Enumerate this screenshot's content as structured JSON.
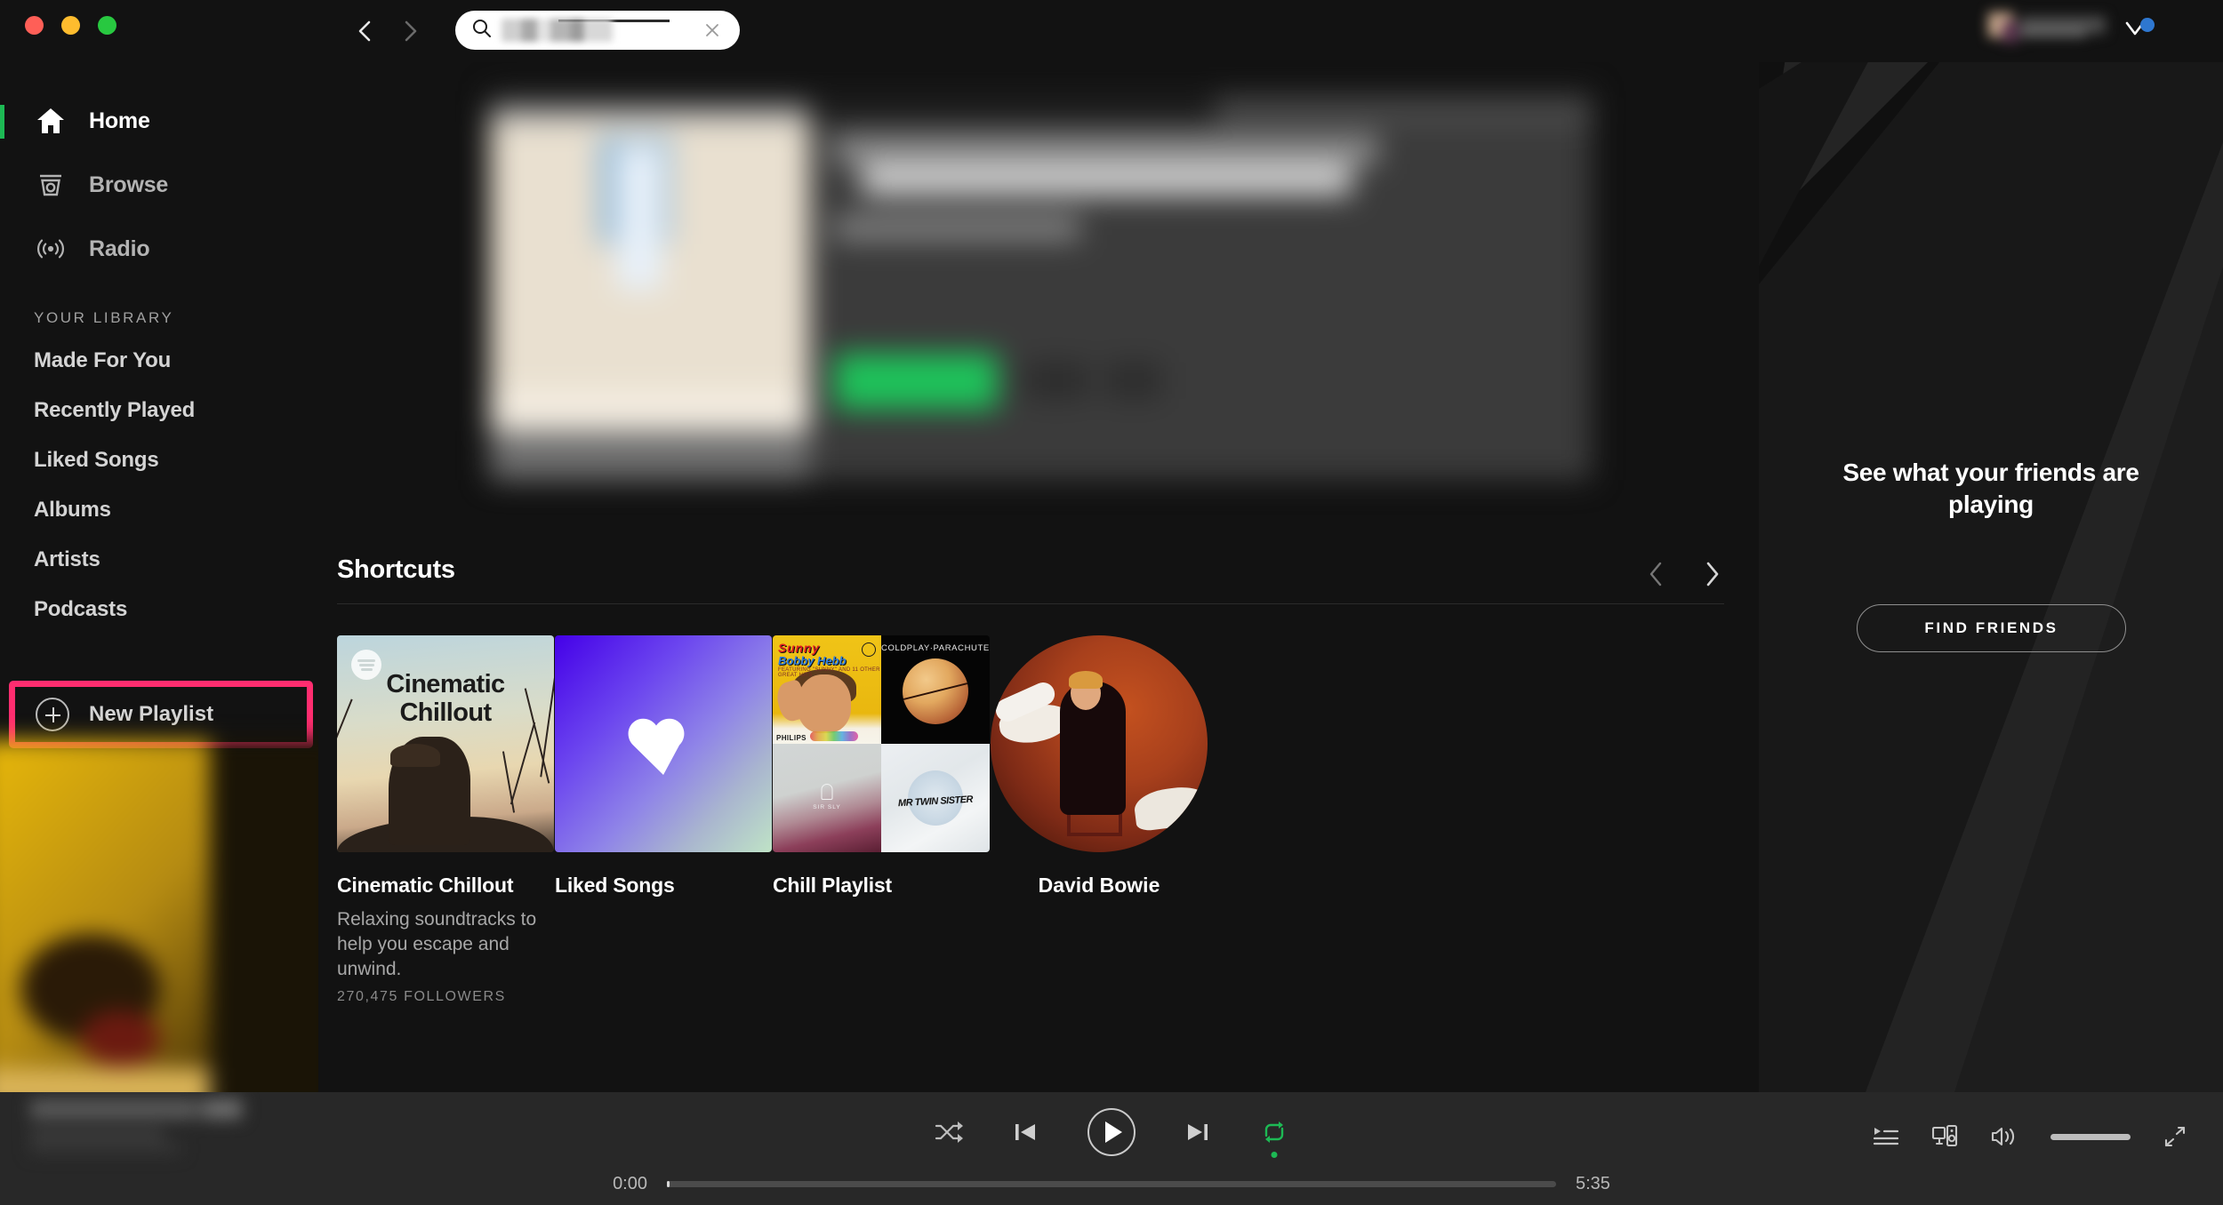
{
  "window": {
    "traffic_lights": [
      "close",
      "minimize",
      "zoom"
    ],
    "colors": {
      "close": "#FF5F57",
      "minimize": "#FEBC2E",
      "zoom": "#28C840"
    }
  },
  "topbar": {
    "back_icon": "chevron-left-icon",
    "forward_icon": "chevron-right-icon",
    "search": {
      "icon": "search-icon",
      "value": "",
      "placeholder": "",
      "redacted": true,
      "clear_icon": "close-icon"
    },
    "user": {
      "name": "",
      "redacted": true,
      "chevron_icon": "chevron-down-icon",
      "badge_color": "#2e77d0"
    }
  },
  "sidebar": {
    "nav": [
      {
        "label": "Home",
        "icon": "home-icon",
        "active": true
      },
      {
        "label": "Browse",
        "icon": "browse-icon",
        "active": false
      },
      {
        "label": "Radio",
        "icon": "radio-icon",
        "active": false
      }
    ],
    "library_heading": "YOUR LIBRARY",
    "library": [
      {
        "label": "Made For You"
      },
      {
        "label": "Recently Played"
      },
      {
        "label": "Liked Songs"
      },
      {
        "label": "Albums"
      },
      {
        "label": "Artists"
      },
      {
        "label": "Podcasts"
      }
    ],
    "new_playlist": {
      "label": "New Playlist",
      "icon": "plus-circle-icon",
      "highlighted": true,
      "highlight_color": "#FF2D6F"
    },
    "active_indicator_color": "#1DB954"
  },
  "main": {
    "hero": {
      "redacted": true,
      "has_green_button": true
    },
    "shortcuts": {
      "title": "Shortcuts",
      "prev_icon": "chevron-left-icon",
      "next_icon": "chevron-right-icon",
      "cards": [
        {
          "title": "Cinematic Chillout",
          "description": "Relaxing soundtracks to help you escape and unwind.",
          "subtitle": "270,475 FOLLOWERS",
          "art_text_line1": "Cinematic",
          "art_text_line2": "Chillout",
          "art_badge": "spotify-logo-icon",
          "shape": "square"
        },
        {
          "title": "Liked Songs",
          "description": "",
          "art_icon": "heart-icon",
          "shape": "square"
        },
        {
          "title": "Chill Playlist",
          "description": "",
          "shape": "square",
          "collage": [
            {
              "artist": "Bobby Hebb",
              "album": "Sunny",
              "label": "PHILIPS"
            },
            {
              "artist": "Coldplay",
              "album": "Parachutes",
              "caption": "COLDPLAY·PARACHUTES"
            },
            {
              "artist": "Sir Sly",
              "album": "",
              "caption": "SIR SLY"
            },
            {
              "artist": "Mr Twin Sister",
              "album": "",
              "caption": "MR TWIN SISTER"
            }
          ]
        },
        {
          "title": "David Bowie",
          "description": "",
          "shape": "circle"
        }
      ]
    }
  },
  "friends_panel": {
    "title": "See what your friends are playing",
    "button_label": "FIND FRIENDS"
  },
  "player": {
    "now_playing": {
      "title": "",
      "artist": "",
      "redacted": true
    },
    "shuffle_icon": "shuffle-icon",
    "previous_icon": "skip-previous-icon",
    "play_icon": "play-icon",
    "next_icon": "skip-next-icon",
    "repeat_icon": "repeat-icon",
    "repeat_active": true,
    "repeat_active_color": "#1DB954",
    "elapsed_time": "0:00",
    "total_time": "5:35",
    "progress_percent": 0,
    "queue_icon": "queue-icon",
    "devices_icon": "connect-device-icon",
    "volume_icon": "volume-icon",
    "volume_percent": 100,
    "fullscreen_icon": "fullscreen-icon"
  }
}
